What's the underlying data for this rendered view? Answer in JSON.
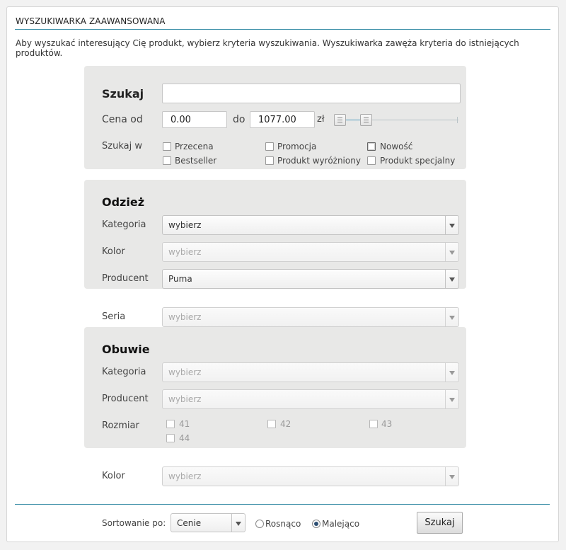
{
  "header": {
    "title": "WYSZUKIWARKA ZAAWANSOWANA",
    "intro": "Aby wyszukać interesujący Cię produkt, wybierz kryteria wyszukiwania. Wyszukiwarka zawęża kryteria do istniejących produktów."
  },
  "search": {
    "label": "Szukaj",
    "value": "",
    "price_from_label": "Cena od",
    "price_from": "0.00",
    "price_to_label": "do",
    "price_to": "1077.00",
    "currency": "zł",
    "search_in_label": "Szukaj w",
    "options": [
      "Przecena",
      "Promocja",
      "Nowość",
      "Bestseller",
      "Produkt wyróżniony",
      "Produkt specjalny"
    ]
  },
  "odziez": {
    "title": "Odzież",
    "kategoria_label": "Kategoria",
    "kategoria_value": "wybierz",
    "kolor_label": "Kolor",
    "kolor_value": "wybierz",
    "producent_label": "Producent",
    "producent_value": "Puma"
  },
  "seria": {
    "label": "Seria",
    "value": "wybierz"
  },
  "obuwie": {
    "title": "Obuwie",
    "kategoria_label": "Kategoria",
    "kategoria_value": "wybierz",
    "producent_label": "Producent",
    "producent_value": "wybierz",
    "rozmiar_label": "Rozmiar",
    "sizes": [
      "41",
      "42",
      "43",
      "44"
    ]
  },
  "kolor": {
    "label": "Kolor",
    "value": "wybierz"
  },
  "sort": {
    "label": "Sortowanie po:",
    "value": "Cenie",
    "asc_label": "Rosnąco",
    "desc_label": "Malejąco",
    "submit_label": "Szukaj"
  },
  "colors": {
    "accent_line": "#3c8fa8",
    "box_bg": "#e8e8e7",
    "slider_range": "#4f9bbd"
  }
}
